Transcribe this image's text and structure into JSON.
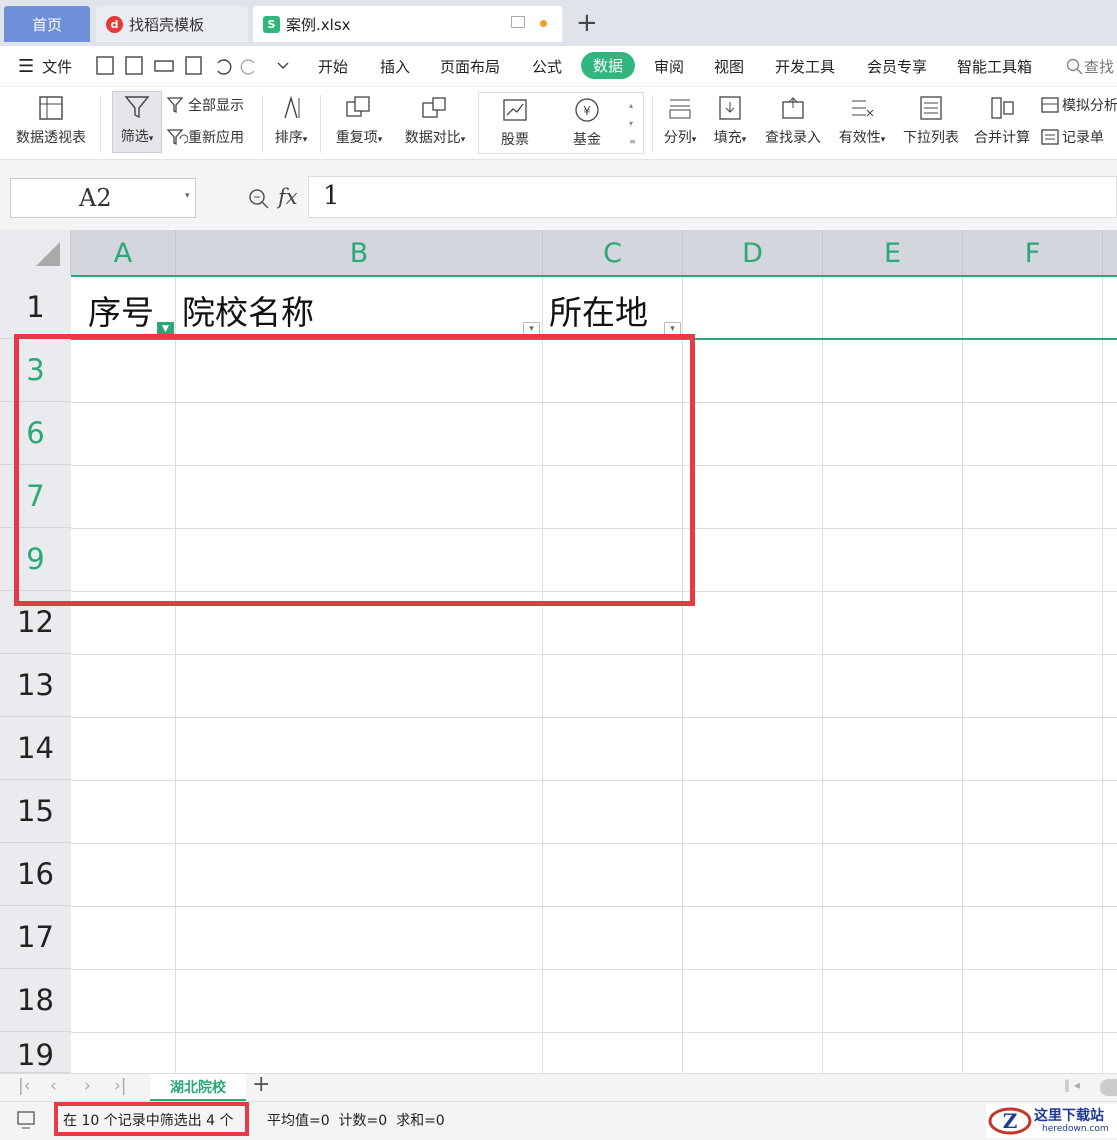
{
  "tabs": {
    "home": "首页",
    "template": "找稻壳模板",
    "file": "案例.xlsx",
    "add": "+"
  },
  "menu": {
    "file": "文件",
    "items": [
      "开始",
      "插入",
      "页面布局",
      "公式",
      "数据",
      "审阅",
      "视图",
      "开发工具",
      "会员专享",
      "智能工具箱"
    ],
    "active": "数据",
    "search": "查找"
  },
  "ribbon": {
    "pivot": "数据透视表",
    "filter": "筛选",
    "show_all": "全部显示",
    "reapply": "重新应用",
    "sort": "排序",
    "duplicates": "重复项",
    "compare": "数据对比",
    "stock": "股票",
    "fund": "基金",
    "split": "分列",
    "fill": "填充",
    "lookup": "查找录入",
    "validity": "有效性",
    "dropdown": "下拉列表",
    "merge_calc": "合并计算",
    "simulate": "模拟分析",
    "record": "记录单"
  },
  "formula": {
    "cell_ref": "A2",
    "fx": "fx",
    "value": "1"
  },
  "columns": [
    "A",
    "B",
    "C",
    "D",
    "E",
    "F"
  ],
  "rows": [
    "1",
    "3",
    "6",
    "7",
    "9",
    "12",
    "13",
    "14",
    "15",
    "16",
    "17",
    "18",
    "19"
  ],
  "header_row": {
    "a": "序号",
    "b": "院校名称",
    "c": "所在地"
  },
  "sheet": {
    "name": "湖北院校",
    "add": "+"
  },
  "status": {
    "filter_info": "在 10 个记录中筛选出 4 个",
    "stats": "平均值=0  计数=0  求和=0"
  },
  "watermark": {
    "name": "这里下载站",
    "url": "heredown.com"
  },
  "colors": {
    "accent": "#2fb77d",
    "highlight": "#e63b45",
    "filtered_row": "#2aa876"
  }
}
